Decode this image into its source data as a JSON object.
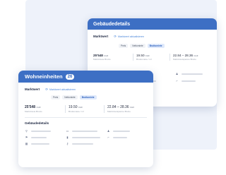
{
  "back_card": {
    "title": "Gebäudedetails",
    "marktwert": {
      "label": "Marktwert",
      "link": "Marktwert aktualisieren"
    },
    "tabs": [
      {
        "label": "Preis",
        "active": false
      },
      {
        "label": "Nettomiete",
        "active": false
      },
      {
        "label": "Bruttomiete",
        "active": true
      }
    ],
    "prices": [
      {
        "value": "25'548",
        "unit": "CHF",
        "sub": "Marktmiete Brutto"
      },
      {
        "value": "19.50",
        "unit": "CHF",
        "sub": "Bruttomiete / m²"
      },
      {
        "value": "22.84 – 28.36",
        "unit": "CHF",
        "sub": "Marktmietspanne Brutto"
      }
    ],
    "detail_icons": [
      "building-icon",
      "person-icon",
      "grid-icon",
      "stair-icon"
    ]
  },
  "front_card": {
    "title": "Wohneinheiten",
    "count": "26",
    "marktwert": {
      "label": "Marktwert",
      "link": "Marktwert aktualisieren"
    },
    "tabs": [
      {
        "label": "Preis",
        "active": false
      },
      {
        "label": "Nettomiete",
        "active": false
      },
      {
        "label": "Bruttomiete",
        "active": true
      }
    ],
    "prices": [
      {
        "value": "25'548",
        "unit": "CHF",
        "sub": "Marktmiete Brutto"
      },
      {
        "value": "19.50",
        "unit": "CHF",
        "sub": "Bruttomiete / m²"
      },
      {
        "value": "22.84 – 28.36",
        "unit": "CHF",
        "sub": "Marktmietspanne Brutto"
      }
    ],
    "details_title": "Gebäudedetails",
    "detail_icons": [
      "pin-icon",
      "calendar-icon",
      "person-icon",
      "flag-icon",
      "door-icon",
      "stair-icon",
      "grid-icon",
      "key-icon"
    ]
  },
  "colors": {
    "header_blue": "#3d6fc4",
    "link_blue": "#4a86d9",
    "background_tint": "#eef2fa"
  }
}
